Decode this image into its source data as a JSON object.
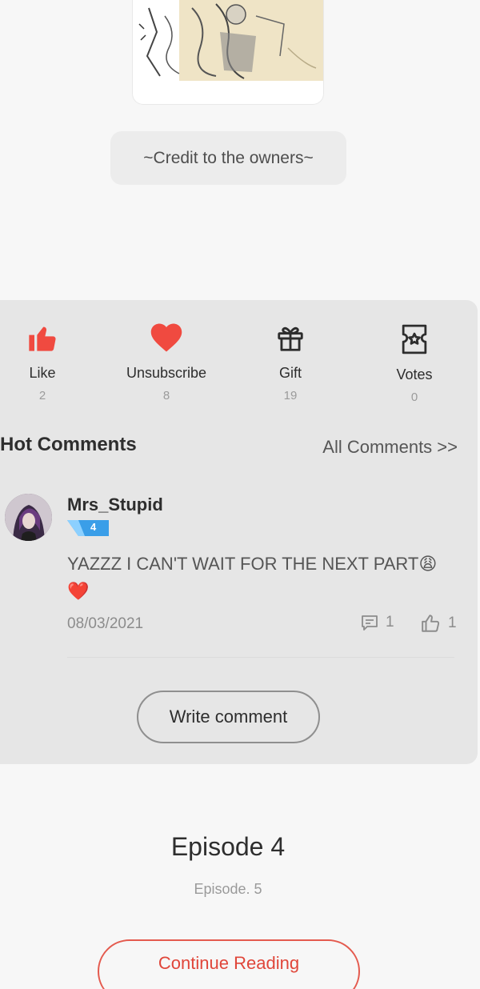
{
  "credit": {
    "text": "~Credit to the owners~"
  },
  "actions": [
    {
      "label": "Like",
      "count": "2",
      "icon": "thumbs-up-icon"
    },
    {
      "label": "Unsubscribe",
      "count": "8",
      "icon": "heart-icon"
    },
    {
      "label": "Gift",
      "count": "19",
      "icon": "gift-icon"
    },
    {
      "label": "Votes",
      "count": "0",
      "icon": "vote-ticket-icon"
    }
  ],
  "comments_section": {
    "title": "Hot Comments",
    "all_link": "All Comments >>",
    "comments": [
      {
        "user": "Mrs_Stupid",
        "level": "4",
        "text": "YAZZZ I CAN'T WAIT FOR THE NEXT PART😩❤️",
        "date": "08/03/2021",
        "replies": "1",
        "likes": "1"
      }
    ],
    "write_button": "Write comment"
  },
  "episode": {
    "title": "Episode 4",
    "subtitle": "Episode. 5",
    "continue_button": "Continue Reading"
  },
  "colors": {
    "accent_red": "#f04a40",
    "button_red": "#e0463a",
    "badge_blue": "#3a9ee8"
  }
}
